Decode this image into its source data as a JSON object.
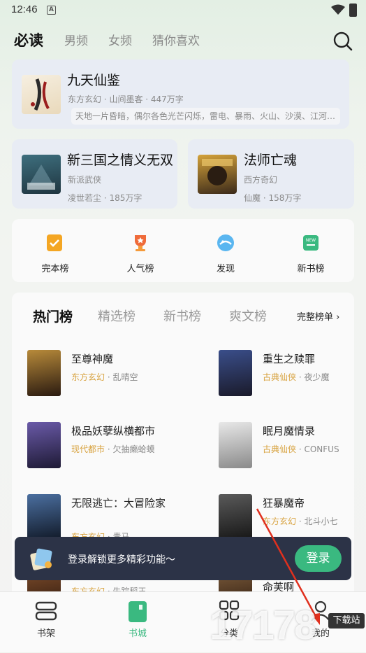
{
  "status": {
    "time": "12:46",
    "sim_badge": "A"
  },
  "tabs": [
    {
      "label": "必读",
      "active": true
    },
    {
      "label": "男频"
    },
    {
      "label": "女频"
    },
    {
      "label": "猜你喜欢"
    }
  ],
  "featured": {
    "title": "九天仙鉴",
    "meta": "东方玄幻 · 山间墨客 · 447万字",
    "desc": "天地一片昏暗，偶尔各色光芒闪烁，雷电、暴雨、火山、沙漠、江河…"
  },
  "half_cards": [
    {
      "title": "新三国之情义无双",
      "category": "新派武侠",
      "meta": "凌世若尘 · 185万字"
    },
    {
      "title": "法师亡魂",
      "category": "西方奇幻",
      "meta": "仙魔 · 158万字"
    }
  ],
  "quick_links": [
    {
      "label": "完本榜",
      "icon": "finished-list-icon"
    },
    {
      "label": "人气榜",
      "icon": "trophy-icon"
    },
    {
      "label": "发现",
      "icon": "discover-icon"
    },
    {
      "label": "新书榜",
      "icon": "new-book-icon"
    }
  ],
  "rank": {
    "tabs": [
      "热门榜",
      "精选榜",
      "新书榜",
      "爽文榜"
    ],
    "more_label": "完整榜单",
    "books": [
      {
        "title": "至尊神魔",
        "category": "东方玄幻",
        "author": "乱晴空"
      },
      {
        "title": "重生之赎罪",
        "category": "古典仙侠",
        "author": "夜少魔"
      },
      {
        "title": "极品妖孽纵横都市",
        "category": "现代都市",
        "author": "欠抽癞蛤蟆"
      },
      {
        "title": "眠月魔情录",
        "category": "古典仙侠",
        "author": "CONFUS"
      },
      {
        "title": "无限逃亡：大冒险家",
        "category": "东方玄幻",
        "author": "青马"
      },
      {
        "title": "狂暴魔帝",
        "category": "东方玄幻",
        "author": "北斗小七"
      },
      {
        "title": "",
        "category": "东方玄幻",
        "author": "失踪稻王"
      },
      {
        "title": "命芙啊",
        "category": "",
        "author": ""
      }
    ]
  },
  "login_bar": {
    "text": "登录解锁更多精彩功能～",
    "button": "登录"
  },
  "bottom_nav": [
    {
      "label": "书架",
      "icon": "bookshelf-icon"
    },
    {
      "label": "书城",
      "icon": "bookstore-icon",
      "active": true
    },
    {
      "label": "分类",
      "icon": "category-grid-icon"
    },
    {
      "label": "我的",
      "icon": "profile-icon"
    }
  ],
  "watermark": {
    "text": "17178",
    "sub": "下载站"
  },
  "colors": {
    "accent": "#3ab980",
    "category": "#d8a340",
    "login_bar": "#2c3347",
    "card": "#e8ecf4"
  }
}
